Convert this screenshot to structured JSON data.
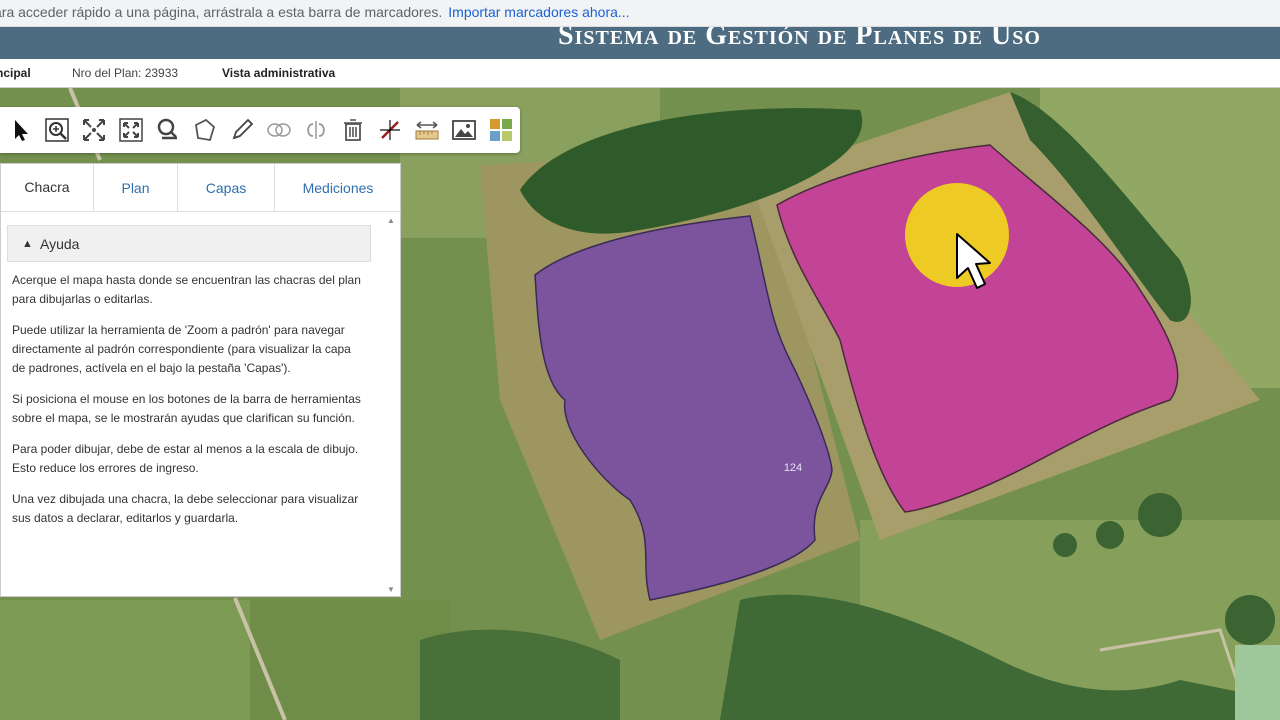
{
  "browser": {
    "bookmarks_message": "ara acceder rápido a una página, arrástrala a esta barra de marcadores.",
    "import_link": "Importar marcadores ahora..."
  },
  "header": {
    "title": "Sistema de Gestión de Planes de Uso"
  },
  "info_bar": {
    "breadcrumb": "ncipal",
    "plan_number": "Nro del Plan: 23933",
    "admin_view": "Vista administrativa"
  },
  "toolbar": {
    "tools": [
      "pointer-icon",
      "zoom-padron-icon",
      "pan-icon",
      "extent-icon",
      "search-icon",
      "polygon-icon",
      "edit-icon",
      "merge-icon",
      "split-icon",
      "delete-icon",
      "measure-icon",
      "distance-icon",
      "image-icon",
      "layers-grid-icon"
    ]
  },
  "tabs": [
    {
      "label": "Chacra",
      "active": true
    },
    {
      "label": "Plan",
      "active": false
    },
    {
      "label": "Capas",
      "active": false
    },
    {
      "label": "Mediciones",
      "active": false
    }
  ],
  "help": {
    "title": "Ayuda",
    "paragraphs": [
      "Acerque el mapa hasta donde se encuentran las chacras del plan para dibujarlas o editarlas.",
      "Puede utilizar la herramienta de 'Zoom a padrón' para navegar directamente al padrón correspondiente (para visualizar la capa de padrones, actívela en el bajo la pestaña 'Capas').",
      "Si posiciona el mouse en los botones de la barra de herramientas sobre el mapa, se le mostrarán ayudas que clarifican su función.",
      "Para poder dibujar, debe de estar al menos a la escala de dibujo. Esto reduce los errores de ingreso.",
      "Una vez dibujada una chacra, la debe seleccionar para visualizar sus datos a declarar, editarlos y guardarla."
    ]
  },
  "map": {
    "parcel_label": "124",
    "colors": {
      "parcel_purple": "#7a4fa3",
      "parcel_pink": "#c63c9a",
      "cursor_highlight": "#f0d21f"
    }
  }
}
